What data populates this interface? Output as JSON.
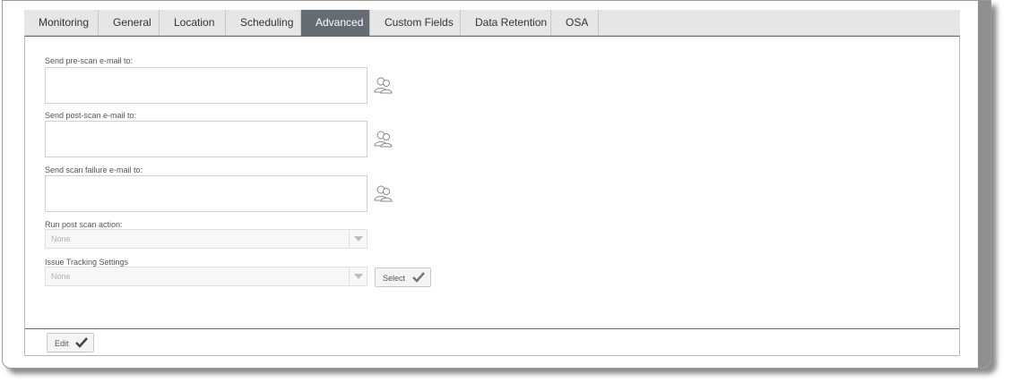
{
  "tabs": [
    {
      "label": "Monitoring",
      "active": false
    },
    {
      "label": "General",
      "active": false
    },
    {
      "label": "Location",
      "active": false
    },
    {
      "label": "Scheduling",
      "active": false
    },
    {
      "label": "Advanced",
      "active": true
    },
    {
      "label": "Custom Fields",
      "active": false
    },
    {
      "label": "Data Retention",
      "active": false
    },
    {
      "label": "OSA",
      "active": false
    }
  ],
  "advanced": {
    "pre_scan_label": "Send pre-scan e-mail to:",
    "pre_scan_value": "",
    "post_scan_label": "Send post-scan e-mail to:",
    "post_scan_value": "",
    "failure_label": "Send scan failure e-mail to:",
    "failure_value": "",
    "post_action_label": "Run post scan action:",
    "post_action_value": "None",
    "issue_tracking_label": "Issue Tracking Settings",
    "issue_tracking_value": "None",
    "select_button": "Select",
    "edit_button": "Edit"
  },
  "icons": {
    "people": "people-icon",
    "check": "checkmark-icon"
  },
  "colors": {
    "active_tab": "#666c73",
    "tab_bar": "#e6e6e6"
  }
}
